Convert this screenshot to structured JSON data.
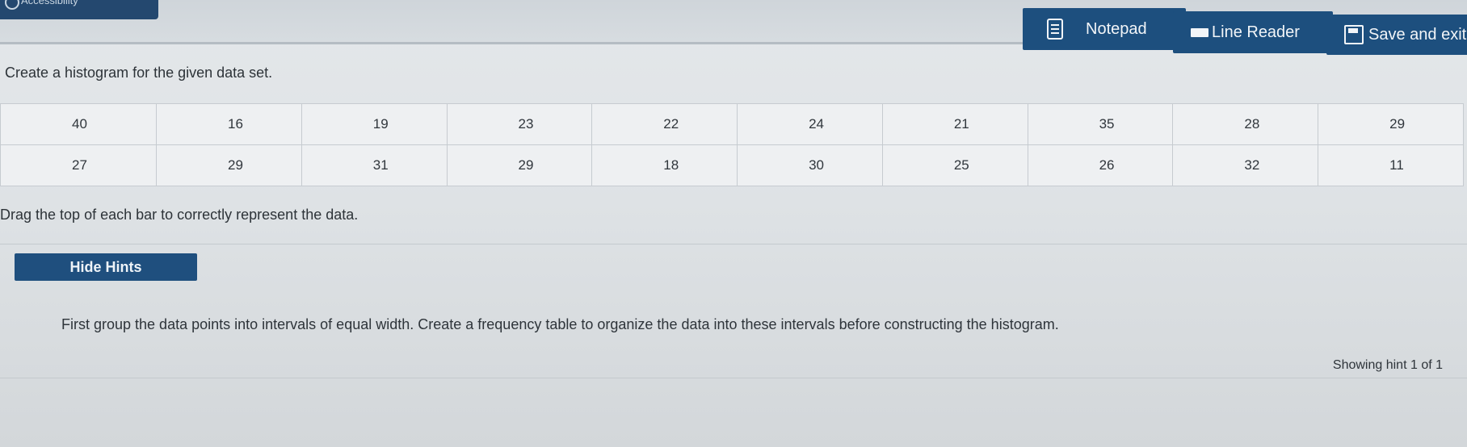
{
  "topbar": {
    "accessibility_label": "Accessibility",
    "notepad_label": "Notepad",
    "line_reader_label": "Line Reader",
    "save_exit_label": "Save and exit"
  },
  "question": {
    "prompt": "Create a histogram for the given data set.",
    "instruction": "Drag the top of each bar to correctly represent the data."
  },
  "data_table": {
    "rows": [
      [
        "40",
        "16",
        "19",
        "23",
        "22",
        "24",
        "21",
        "35",
        "28",
        "29"
      ],
      [
        "27",
        "29",
        "31",
        "29",
        "18",
        "30",
        "25",
        "26",
        "32",
        "11"
      ]
    ]
  },
  "hints": {
    "toggle_label": "Hide Hints",
    "text": "First group the data points into intervals of equal width. Create a frequency table to organize the data into these intervals before constructing the histogram.",
    "counter": "Showing hint 1 of 1"
  },
  "colors": {
    "accent": "#1f4f7e",
    "background": "#dfe3e6"
  }
}
